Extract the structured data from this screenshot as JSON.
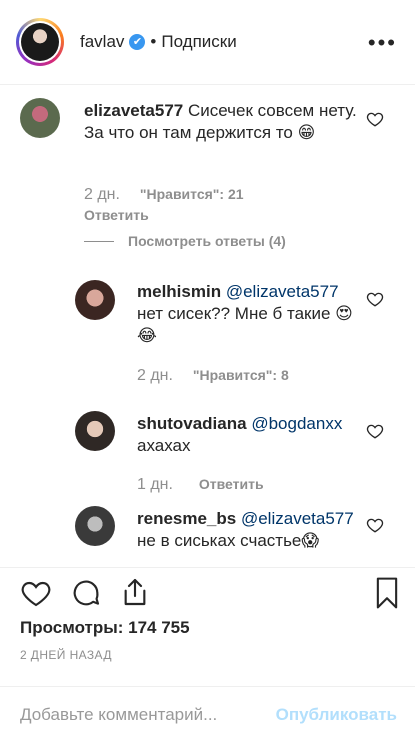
{
  "header": {
    "username": "favlav",
    "verified_mark": "✔",
    "separator": "•",
    "follow_state": "Подписки",
    "more_label": "•••"
  },
  "comments": [
    {
      "user": "elizaveta577",
      "text": "Сисечек совсем нету. За что он там держится то",
      "emoji": "😁",
      "time": "2 дн.",
      "likes": "\"Нравится\": 21",
      "reply": "Ответить"
    }
  ],
  "view_replies": "Посмотреть ответы (4)",
  "replies": [
    {
      "user": "melhismin",
      "mention": "@elizaveta577",
      "text": "нет сисек?? Мне б такие",
      "emoji": "😍😂",
      "time": "2 дн.",
      "likes": "\"Нравится\": 8"
    },
    {
      "user": "shutovadiana",
      "mention": "@bogdanxx",
      "text": "ахахах",
      "time": "1 дн.",
      "reply": "Ответить"
    },
    {
      "user": "renesme_bs",
      "mention": "@elizaveta577",
      "text": "не в сиськах счастье",
      "emoji": "😱"
    }
  ],
  "footer": {
    "views": "Просмотры: 174 755",
    "posted": "2 ДНЕЙ НАЗАД",
    "comment_placeholder": "Добавьте комментарий...",
    "publish": "Опубликовать"
  },
  "colors": {
    "text": "#262626",
    "muted": "#8e8e8e",
    "mention": "#003569",
    "verified": "#3897f0",
    "publish_disabled": "#b2dffc"
  },
  "icons": [
    "heart-icon",
    "comment-icon",
    "share-icon",
    "bookmark-icon",
    "verified-icon",
    "more-icon"
  ]
}
